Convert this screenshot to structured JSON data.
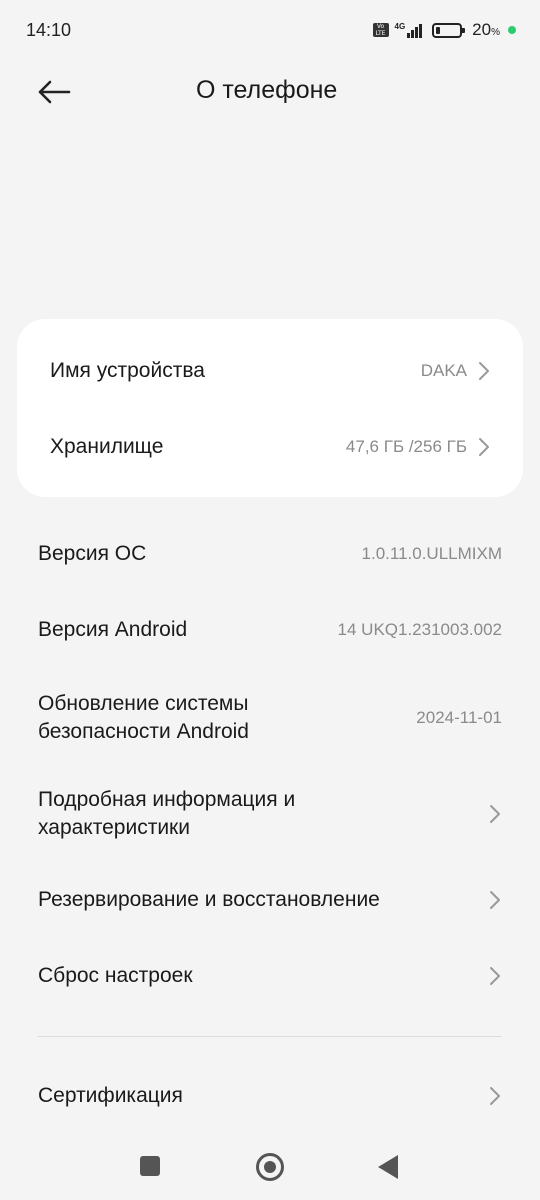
{
  "status": {
    "time": "14:10",
    "volte": "Vo LTE",
    "network": "4G",
    "battery_value": "20",
    "battery_unit": "%"
  },
  "header": {
    "title": "О телефоне",
    "back_icon": "arrow-left-icon"
  },
  "card": {
    "items": [
      {
        "label": "Имя устройства",
        "value": "DAKA"
      },
      {
        "label": "Хранилище",
        "value": "47,6 ГБ /256 ГБ"
      }
    ]
  },
  "list": {
    "os_version": {
      "label": "Версия ОС",
      "value": "1.0.11.0.ULLMIXM"
    },
    "android_version": {
      "label": "Версия Android",
      "value": "14 UKQ1.231003.002"
    },
    "security_update": {
      "label_line1": "Обновление системы",
      "label_line2": "безопасности Android",
      "value": "2024-11-01"
    },
    "details": {
      "label_line1": "Подробная информация и",
      "label_line2": "характеристики"
    },
    "backup": {
      "label": "Резервирование и восстановление"
    },
    "reset": {
      "label": "Сброс настроек"
    },
    "certification": {
      "label": "Сертификация"
    }
  },
  "colors": {
    "background": "#f4f4f4",
    "card": "#ffffff",
    "secondary_text": "#8a8a8a",
    "battery_dot": "#2ecc71"
  }
}
